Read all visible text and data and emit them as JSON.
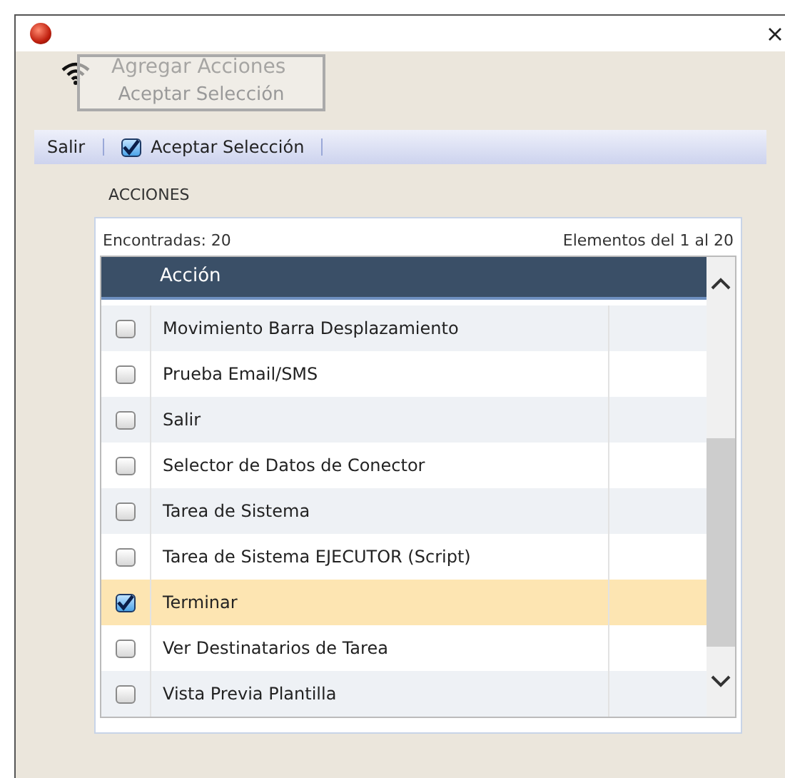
{
  "window": {
    "title": "Agregar Acciones"
  },
  "tooltip": {
    "text": "Aceptar Selección"
  },
  "toolbar": [
    {
      "kind": "button",
      "label": "Salir"
    },
    {
      "kind": "check",
      "label": "Aceptar Selección",
      "checked": true
    }
  ],
  "section_label": "ACCIONES",
  "found": "Encontradas:  20",
  "range": "Elementos del 1 al 20",
  "table": {
    "columns": [
      "Acción"
    ],
    "rows": [
      {
        "label": "Movimiento Barra Desplazamiento",
        "checked": false,
        "selected": false
      },
      {
        "label": "Prueba Email/SMS",
        "checked": false,
        "selected": false
      },
      {
        "label": "Salir",
        "checked": false,
        "selected": false
      },
      {
        "label": "Selector de Datos de Conector",
        "checked": false,
        "selected": false
      },
      {
        "label": "Tarea de Sistema",
        "checked": false,
        "selected": false
      },
      {
        "label": "Tarea de Sistema EJECUTOR (Script)",
        "checked": false,
        "selected": false
      },
      {
        "label": "Terminar",
        "checked": true,
        "selected": true
      },
      {
        "label": "Ver Destinatarios de Tarea",
        "checked": false,
        "selected": false
      },
      {
        "label": "Vista Previa Plantilla",
        "checked": false,
        "selected": false
      }
    ]
  }
}
